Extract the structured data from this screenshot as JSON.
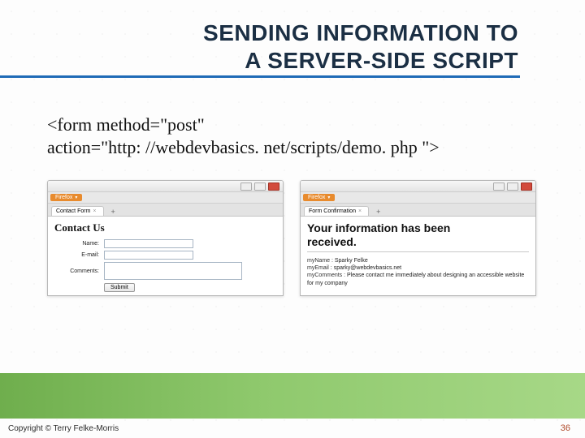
{
  "title": {
    "line1": "SENDING INFORMATION TO",
    "line2": "A SERVER-SIDE SCRIPT"
  },
  "code": {
    "line1": "<form method=\"post\"",
    "line2": "action=\"http: //webdevbasics. net/scripts/demo. php \">"
  },
  "windows": {
    "left": {
      "firefox_label": "Firefox",
      "tab_title": "Contact Form",
      "page_heading": "Contact Us",
      "labels": {
        "name": "Name:",
        "email": "E-mail:",
        "comments": "Comments:"
      },
      "submit_label": "Submit"
    },
    "right": {
      "firefox_label": "Firefox",
      "tab_title": "Form Confirmation",
      "page_heading_l1": "Your information has been",
      "page_heading_l2": "received.",
      "rows": {
        "name_key": "myName :",
        "name_val": "Sparky Felke",
        "email_key": "myEmail :",
        "email_val": "sparky@webdevbasics.net",
        "comments_key": "myComments :",
        "comments_val": "Please contact me immediately about designing an accessible website for my company"
      }
    }
  },
  "footer": "Copyright © Terry Felke-Morris",
  "page_number": "36"
}
